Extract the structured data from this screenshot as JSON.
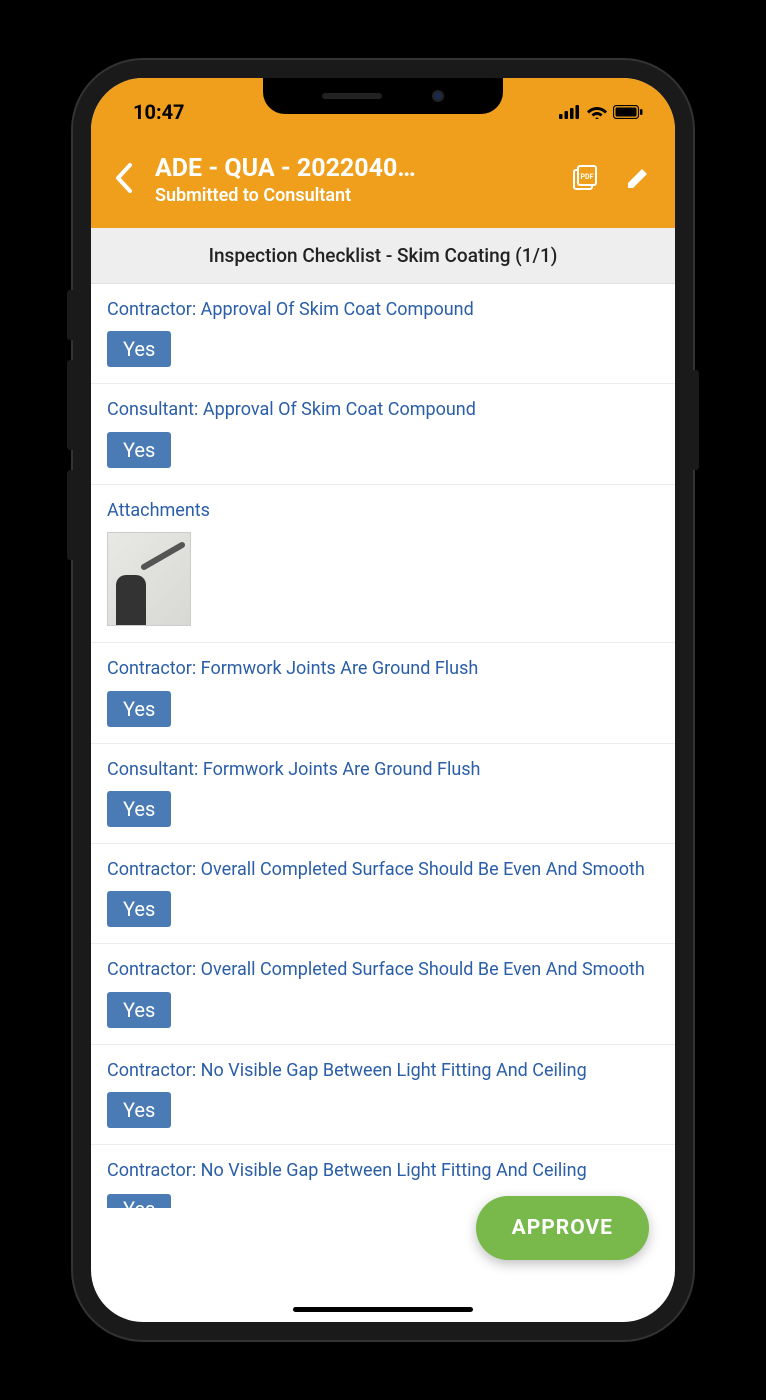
{
  "status": {
    "time": "10:47"
  },
  "header": {
    "title": "ADE - QUA - 2022040…",
    "subtitle": "Submitted to Consultant"
  },
  "section": {
    "title": "Inspection Checklist - Skim Coating (1/1)"
  },
  "items": [
    {
      "label": "Contractor: Approval Of Skim Coat Compound",
      "value": "Yes"
    },
    {
      "label": "Consultant: Approval Of Skim Coat Compound",
      "value": "Yes"
    },
    {
      "label": "Attachments",
      "value": null,
      "attachment": true
    },
    {
      "label": "Contractor: Formwork Joints Are Ground Flush",
      "value": "Yes"
    },
    {
      "label": "Consultant: Formwork Joints Are Ground Flush",
      "value": "Yes"
    },
    {
      "label": "Contractor: Overall Completed Surface Should Be Even And Smooth",
      "value": "Yes"
    },
    {
      "label": "Contractor: Overall Completed Surface Should Be Even And Smooth",
      "value": "Yes"
    },
    {
      "label": "Contractor: No Visible Gap Between Light Fitting And Ceiling",
      "value": "Yes"
    },
    {
      "label": "Contractor: No Visible Gap Between Light Fitting And Ceiling",
      "value": "Yes"
    }
  ],
  "fab": {
    "label": "APPROVE"
  }
}
